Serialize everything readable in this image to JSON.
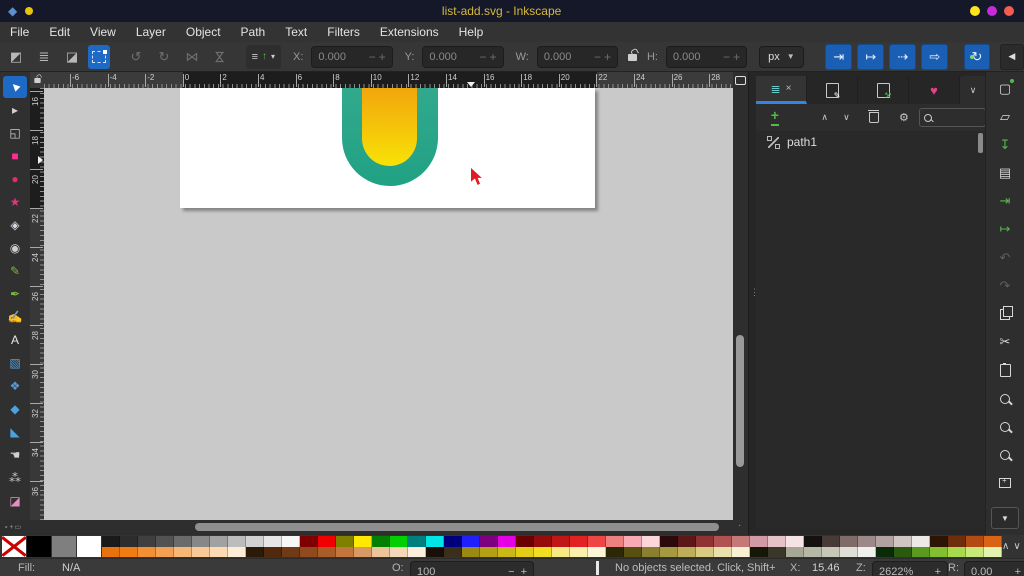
{
  "window": {
    "title": "list-add.svg - Inkscape",
    "controls": [
      {
        "name": "minimize",
        "color": "#ffe61c"
      },
      {
        "name": "maximize",
        "color": "#c42cd6"
      },
      {
        "name": "close",
        "color": "#f25d50"
      }
    ]
  },
  "menu": {
    "items": [
      "File",
      "Edit",
      "View",
      "Layer",
      "Object",
      "Path",
      "Text",
      "Filters",
      "Extensions",
      "Help"
    ]
  },
  "toolbar": {
    "x_label": "X:",
    "x_value": "0.000",
    "y_label": "Y:",
    "y_value": "0.000",
    "w_label": "W:",
    "w_value": "0.000",
    "h_label": "H:",
    "h_value": "0.000",
    "minus": "−",
    "plus": "+",
    "unit": "px",
    "select_buttons": [
      {
        "name": "select-all-button",
        "glyph": "◩"
      },
      {
        "name": "select-all-layers-button",
        "glyph": "≣"
      },
      {
        "name": "deselect-button",
        "glyph": "◪"
      }
    ],
    "transform_buttons": [
      {
        "name": "rotate-ccw-button",
        "glyph": "↺"
      },
      {
        "name": "rotate-cw-button",
        "glyph": "↻"
      },
      {
        "name": "flip-horizontal-button",
        "glyph": "⋈",
        "rot": false
      },
      {
        "name": "flip-vertical-button",
        "glyph": "⋈",
        "rot": true
      }
    ],
    "raise_lower_glyphs": {
      "lines": "≡",
      "arrow": "↑",
      "caret": "▾"
    },
    "scale_toggles": [
      {
        "name": "scale-stroke-toggle",
        "glyph": "⇥"
      },
      {
        "name": "scale-corners-toggle",
        "glyph": "↦"
      },
      {
        "name": "move-gradients-toggle",
        "glyph": "⇢"
      },
      {
        "name": "move-patterns-toggle",
        "glyph": "⇨"
      }
    ],
    "snap_glyph": "↻",
    "collapse_glyph": "◀"
  },
  "toolbox": {
    "tools": [
      {
        "name": "selector-tool",
        "glyph": "►",
        "color": "#ffffff",
        "active": true,
        "cls": "rot-ul"
      },
      {
        "name": "node-tool",
        "glyph": "▸",
        "color": "#cfcfcf"
      },
      {
        "name": "shape-builder-tool",
        "glyph": "◱",
        "color": "#cfcfcf"
      },
      {
        "name": "rectangle-tool",
        "glyph": "■",
        "color": "#ff2f92"
      },
      {
        "name": "ellipse-tool",
        "glyph": "●",
        "color": "#e02a76"
      },
      {
        "name": "star-tool",
        "glyph": "★",
        "color": "#e0357f"
      },
      {
        "name": "box3d-tool",
        "glyph": "◈",
        "color": "#d9d9e6"
      },
      {
        "name": "spiral-tool",
        "glyph": "◉",
        "color": "#cfcfcf"
      },
      {
        "name": "pencil-tool",
        "glyph": "✎",
        "color": "#7ab648"
      },
      {
        "name": "pen-tool",
        "glyph": "✒",
        "color": "#7ab648"
      },
      {
        "name": "calligraphy-tool",
        "glyph": "✍",
        "color": "#7ab648"
      },
      {
        "name": "text-tool",
        "glyph": "A",
        "color": "#e8e8e8"
      },
      {
        "name": "gradient-tool",
        "glyph": "▧",
        "color": "#5b9bd5"
      },
      {
        "name": "mesh-gradient-tool",
        "glyph": "❖",
        "color": "#5b9bd5"
      },
      {
        "name": "dropper-tool",
        "glyph": "◆",
        "color": "#4aa3df"
      },
      {
        "name": "paint-bucket-tool",
        "glyph": "◣",
        "color": "#4aa3df"
      },
      {
        "name": "tweak-tool",
        "glyph": "☚",
        "color": "#d0d0d0"
      },
      {
        "name": "spray-tool",
        "glyph": "⁂",
        "color": "#c9c9c9"
      },
      {
        "name": "eraser-tool",
        "glyph": "◪",
        "color": "#e58cc0"
      }
    ]
  },
  "rulers": {
    "horizontal_numbers": [
      "-6",
      "-4",
      "-2",
      "0",
      "2",
      "4",
      "6",
      "8",
      "10",
      "12",
      "14",
      "16",
      "18",
      "20",
      "22",
      "24",
      "26",
      "28"
    ],
    "vertical_numbers": [
      "16",
      "18",
      "20",
      "22",
      "24",
      "26",
      "28",
      "30",
      "32",
      "34",
      "36"
    ]
  },
  "canvas": {
    "shape": {
      "outer_color": "#21a184",
      "inner_gradient_top": "#f2a60d",
      "inner_gradient_bottom": "#f8e206"
    }
  },
  "dock": {
    "tabs": [
      {
        "name": "tab-objects",
        "active": true
      },
      {
        "name": "tab-xml-editor"
      },
      {
        "name": "tab-object-properties"
      },
      {
        "name": "tab-symbols"
      }
    ],
    "items": [
      {
        "label": "path1"
      }
    ]
  },
  "command_bar": {
    "icons": [
      {
        "name": "new-document-button",
        "glyph": "▢",
        "cls": "",
        "dot": true
      },
      {
        "name": "open-document-button",
        "glyph": "▱",
        "cls": ""
      },
      {
        "name": "save-document-button",
        "glyph": "↧",
        "cls": "green"
      },
      {
        "name": "print-button",
        "glyph": "▤",
        "cls": ""
      },
      {
        "name": "import-button",
        "glyph": "⇥",
        "cls": "green"
      },
      {
        "name": "export-button",
        "glyph": "↦",
        "cls": "green"
      },
      {
        "name": "undo-button",
        "glyph": "↶",
        "cls": "dim"
      },
      {
        "name": "redo-button",
        "glyph": "↷",
        "cls": "dim"
      },
      {
        "name": "duplicate-button",
        "icon": "ic-copy"
      },
      {
        "name": "cut-button",
        "glyph": "✂",
        "cls": ""
      },
      {
        "name": "paste-button",
        "icon": "ic-clip"
      },
      {
        "name": "zoom-selection-button",
        "icon": "ic-zoom"
      },
      {
        "name": "zoom-drawing-button",
        "icon": "ic-zoom"
      },
      {
        "name": "zoom-page-button",
        "icon": "ic-zoom"
      },
      {
        "name": "zoom-page-width-button",
        "icon": "ic-frame"
      }
    ],
    "dropdown_glyph": "▼"
  },
  "palette": {
    "big_swatches": [
      "none",
      "#000000",
      "#7f7f7f",
      "#ffffff"
    ],
    "row1": [
      "#1a1a1a",
      "#2d2d2d",
      "#3f3f3f",
      "#525252",
      "#6b6b6b",
      "#878787",
      "#a1a1a1",
      "#bcbcbc",
      "#d2d2d2",
      "#e6e6e6",
      "#f7f7f7",
      "#7f0000",
      "#f00000",
      "#7f7f00",
      "#ffe900",
      "#007f00",
      "#00d000",
      "#007f7f",
      "#00e5e5",
      "#00007f",
      "#2020ff",
      "#7f007f",
      "#e500e5",
      "#6b0000",
      "#970b0b",
      "#c11616",
      "#e22222",
      "#f04545",
      "#ef8080",
      "#f7aab4",
      "#fcd6db",
      "#2a0a0a",
      "#5c1717",
      "#8f3232",
      "#b05252",
      "#c47878",
      "#d29aa4",
      "#e7c1c8",
      "#f5e3e5",
      "#151110",
      "#483a37",
      "#7f6c69",
      "#9d8a88",
      "#b2a3a1",
      "#cfc6c4",
      "#ece9e8",
      "#2d1404",
      "#6e2e0b",
      "#b34a12",
      "#d96414"
    ],
    "row2": [
      "#e8720e",
      "#ef7d12",
      "#f28f33",
      "#f4a053",
      "#f7b877",
      "#f9c997",
      "#fbdab4",
      "#fdedd6",
      "#2b1a08",
      "#512a0e",
      "#6f3a15",
      "#8f4a1d",
      "#a95c28",
      "#c2763c",
      "#d89a64",
      "#ecc39a",
      "#f3d8b8",
      "#fbeedd",
      "#181008",
      "#3b2f1c",
      "#9a8a12",
      "#b3a013",
      "#cbb717",
      "#e2cd18",
      "#f2de22",
      "#f7ea83",
      "#f9f0ae",
      "#fcf8d7",
      "#2b2808",
      "#585010",
      "#8a7f31",
      "#a6993f",
      "#bfae59",
      "#d7ca81",
      "#e9e1ab",
      "#f6f1d3",
      "#171708",
      "#393827",
      "#a7a796",
      "#b7b7a6",
      "#c7c7b6",
      "#dfdfd6",
      "#f0f0ec",
      "#0a2a08",
      "#2a5a10",
      "#5a9a20",
      "#82c02f",
      "#a7d84e",
      "#c8e87a",
      "#e2f4b0"
    ],
    "controls": {
      "up": "∧",
      "down": "∨",
      "menu": "≡"
    }
  },
  "status": {
    "fill_label": "Fill:",
    "fill_value": "N/A",
    "opacity_label": "O:",
    "opacity_value": "100",
    "message": "No objects selected. Click, Shift+click, Alt+scroll mouse on top of objects, or drag around objects to select.",
    "x_label": "X:",
    "x_value": "15.46",
    "z_label": "Z:",
    "z_value": "2622%",
    "r_label": "R:",
    "r_value": "0.00"
  }
}
